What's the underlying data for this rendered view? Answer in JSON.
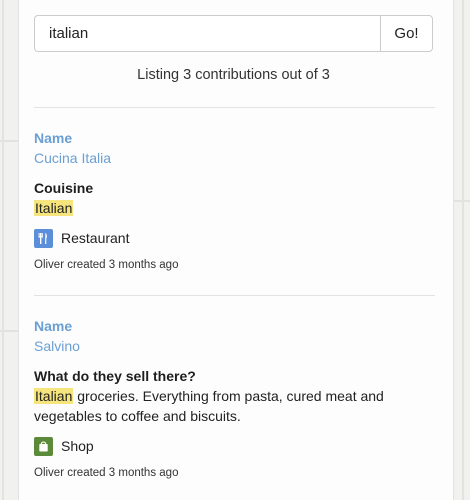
{
  "search": {
    "value": "italian",
    "button_label": "Go!"
  },
  "listing_text": "Listing 3 contributions out of 3",
  "contributions": [
    {
      "name_label": "Name",
      "name": "Cucina Italia",
      "question_label": "Couisine",
      "answer_highlight": "Italian",
      "answer_rest": "",
      "category_icon": "fork-knife-icon",
      "category": "Restaurant",
      "meta": "Oliver created 3 months ago",
      "colors": {
        "icon_bg": "#5b8fd9"
      }
    },
    {
      "name_label": "Name",
      "name": "Salvino",
      "question_label": "What do they sell there?",
      "answer_highlight": "Italian",
      "answer_rest": " groceries. Everything from pasta, cured meat and vegetables to coffee and biscuits.",
      "category_icon": "shopping-bag-icon",
      "category": "Shop",
      "meta": "Oliver created 3 months ago",
      "colors": {
        "icon_bg": "#5b8a3a"
      }
    }
  ],
  "colors": {
    "link": "#6a9fd4",
    "highlight": "#f6e47c"
  }
}
